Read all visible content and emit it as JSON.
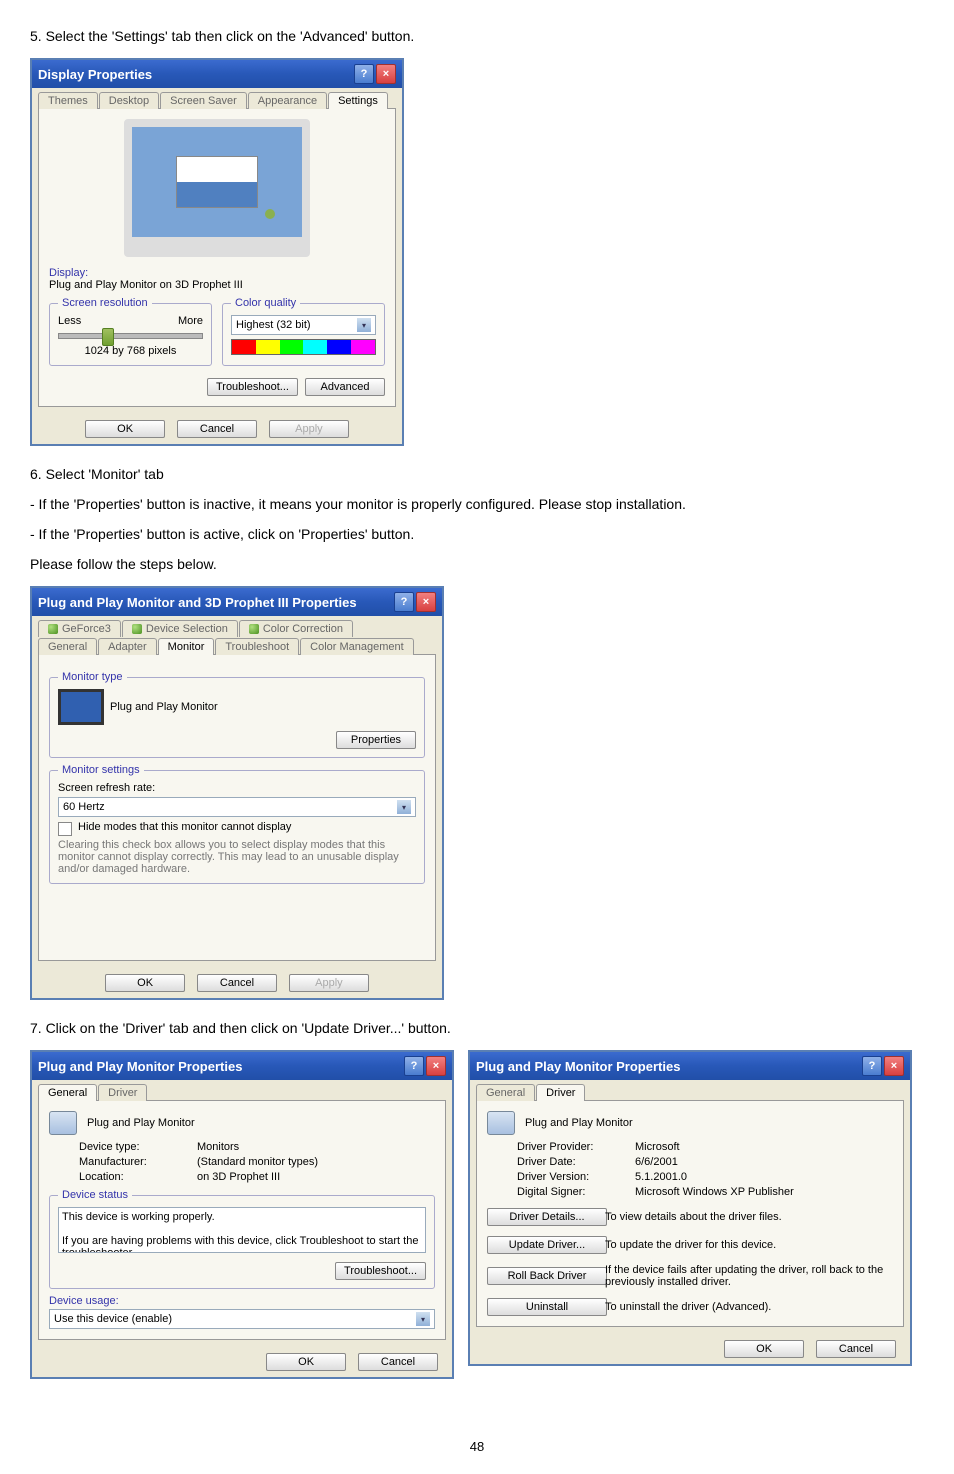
{
  "step5_text": "5. Select the 'Settings' tab then click on the 'Advanced' button.",
  "dlg1": {
    "title": "Display Properties",
    "tabs": [
      "Themes",
      "Desktop",
      "Screen Saver",
      "Appearance",
      "Settings"
    ],
    "display_heading": "Display:",
    "display_value": "Plug and Play Monitor on 3D Prophet III",
    "res_legend": "Screen resolution",
    "res_less": "Less",
    "res_more": "More",
    "res_value": "1024 by 768 pixels",
    "color_legend": "Color quality",
    "color_value": "Highest (32 bit)",
    "troubleshoot": "Troubleshoot...",
    "advanced": "Advanced",
    "ok": "OK",
    "cancel": "Cancel",
    "apply": "Apply"
  },
  "step6_title": "6. Select 'Monitor' tab",
  "step6_line1": "- If the 'Properties' button is inactive, it means your monitor is properly configured. Please stop installation.",
  "step6_line2": "- If the 'Properties' button is active, click on 'Properties' button.",
  "step6_line3": "Please follow the steps below.",
  "dlg2": {
    "title": "Plug and Play Monitor and 3D Prophet III Properties",
    "tabs_top": [
      "GeForce3",
      "Device Selection",
      "Color Correction"
    ],
    "tabs_bottom": [
      "General",
      "Adapter",
      "Monitor",
      "Troubleshoot",
      "Color Management"
    ],
    "montype_legend": "Monitor type",
    "montype_value": "Plug and Play Monitor",
    "properties_btn": "Properties",
    "monset_legend": "Monitor settings",
    "refresh_label": "Screen refresh rate:",
    "refresh_value": "60 Hertz",
    "hide_modes": "Hide modes that this monitor cannot display",
    "hide_desc": "Clearing this check box allows you to select display modes that this monitor cannot display correctly. This may lead to an unusable display and/or damaged hardware.",
    "ok": "OK",
    "cancel": "Cancel",
    "apply": "Apply"
  },
  "step7_text": "7. Click on the 'Driver' tab and then click on 'Update Driver...' button.",
  "dlg3": {
    "title": "Plug and Play Monitor Properties",
    "tabs": [
      "General",
      "Driver"
    ],
    "device_name": "Plug and Play Monitor",
    "devtype_label": "Device type:",
    "devtype_value": "Monitors",
    "manuf_label": "Manufacturer:",
    "manuf_value": "(Standard monitor types)",
    "loc_label": "Location:",
    "loc_value": "on 3D Prophet III",
    "status_legend": "Device status",
    "status_text": "This device is working properly.\n\nIf you are having problems with this device, click Troubleshoot to start the troubleshooter.",
    "troubleshoot_btn": "Troubleshoot...",
    "usage_label": "Device usage:",
    "usage_value": "Use this device (enable)",
    "ok": "OK",
    "cancel": "Cancel"
  },
  "dlg4": {
    "title": "Plug and Play Monitor Properties",
    "tabs": [
      "General",
      "Driver"
    ],
    "device_name": "Plug and Play Monitor",
    "provider_label": "Driver Provider:",
    "provider_value": "Microsoft",
    "date_label": "Driver Date:",
    "date_value": "6/6/2001",
    "version_label": "Driver Version:",
    "version_value": "5.1.2001.0",
    "signer_label": "Digital Signer:",
    "signer_value": "Microsoft Windows XP Publisher",
    "details_btn": "Driver Details...",
    "details_desc": "To view details about the driver files.",
    "update_btn": "Update Driver...",
    "update_desc": "To update the driver for this device.",
    "rollback_btn": "Roll Back Driver",
    "rollback_desc": "If the device fails after updating the driver, roll back to the previously installed driver.",
    "uninstall_btn": "Uninstall",
    "uninstall_desc": "To uninstall the driver (Advanced).",
    "ok": "OK",
    "cancel": "Cancel"
  },
  "page_number": "48"
}
